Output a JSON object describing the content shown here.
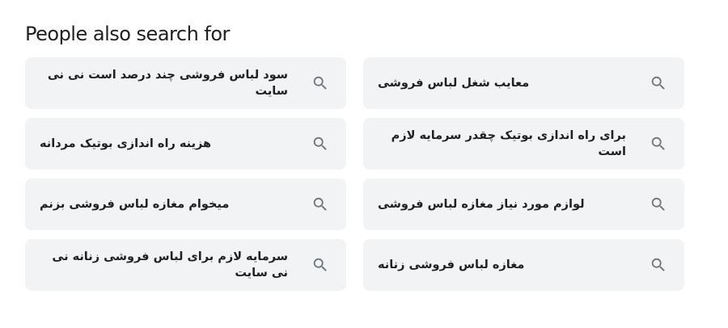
{
  "section": {
    "title": "People also search for"
  },
  "colors": {
    "chip_background": "#f1f3f4",
    "text": "#202124",
    "icon": "#70757a"
  },
  "icons": {
    "search": "search-icon"
  },
  "suggestions": [
    {
      "label": "سود لباس فروشی چند درصد است نی نی سایت"
    },
    {
      "label": "معایب شغل لباس فروشی"
    },
    {
      "label": "هزینه راه اندازی بوتیک مردانه"
    },
    {
      "label": "برای راه اندازی بوتیک چقدر سرمایه لازم است"
    },
    {
      "label": "میخوام مغازه لباس فروشی بزنم"
    },
    {
      "label": "لوازم مورد نیاز مغازه لباس فروشی"
    },
    {
      "label": "سرمایه لازم برای لباس فروشی زنانه نی نی سایت"
    },
    {
      "label": "مغازه لباس فروشی زنانه"
    }
  ]
}
